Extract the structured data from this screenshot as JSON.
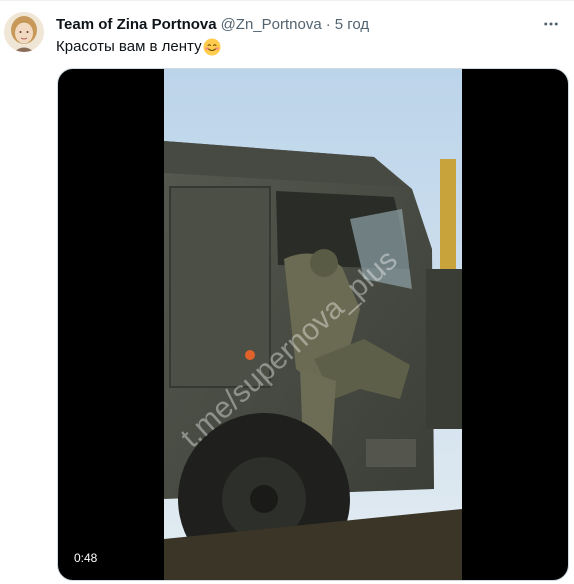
{
  "tweet": {
    "display_name": "Team of Zina Portnova",
    "handle": "@Zn_Portnova",
    "separator": "·",
    "timestamp": "5 год",
    "text": "Красоты вам в ленту",
    "emoji": "smiling-face-with-smiling-eyes",
    "media": {
      "type": "video",
      "duration": "0:48",
      "watermark": "t.me/supernova_plus"
    }
  },
  "icons": {
    "more": "more-horizontal-icon"
  },
  "colors": {
    "primary_text": "#0f1419",
    "secondary_text": "#536471",
    "border": "#cfd9de"
  }
}
